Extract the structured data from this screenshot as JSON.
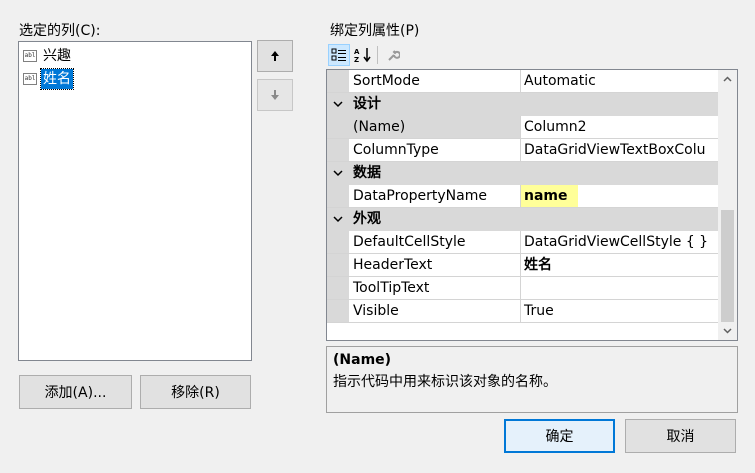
{
  "selected_columns": {
    "label": "选定的列(C):",
    "items": [
      {
        "icon": "abl",
        "text": "兴趣",
        "selected": false
      },
      {
        "icon": "abl",
        "text": "姓名",
        "selected": true
      }
    ]
  },
  "move": {
    "up_icon": "arrow-up-icon",
    "down_icon": "arrow-down-icon"
  },
  "buttons": {
    "add": "添加(A)...",
    "remove": "移除(R)",
    "ok": "确定",
    "cancel": "取消"
  },
  "properties": {
    "label": "绑定列属性(P)",
    "toolbar": [
      "categorized-icon",
      "alphabetical-icon",
      "property-pages-icon"
    ],
    "rows": {
      "sortmode": {
        "name": "SortMode",
        "value": "Automatic"
      },
      "cat_design": "设计",
      "name": {
        "name": "(Name)",
        "value": "Column2"
      },
      "columntype": {
        "name": "ColumnType",
        "value": "DataGridViewTextBoxColu"
      },
      "cat_data": "数据",
      "datapropertyname": {
        "name": "DataPropertyName",
        "value": "name"
      },
      "cat_appearance": "外观",
      "defaultcellstyle": {
        "name": "DefaultCellStyle",
        "value": "DataGridViewCellStyle { }"
      },
      "headertext": {
        "name": "HeaderText",
        "value": "姓名"
      },
      "tooltiptext": {
        "name": "ToolTipText",
        "value": ""
      },
      "visible": {
        "name": "Visible",
        "value": "True"
      }
    },
    "description": {
      "title": "(Name)",
      "text": "指示代码中用来标识该对象的名称。"
    }
  },
  "colors": {
    "accent": "#0078d7",
    "highlight": "#ffff99",
    "category_bg": "#d9d9d9"
  }
}
